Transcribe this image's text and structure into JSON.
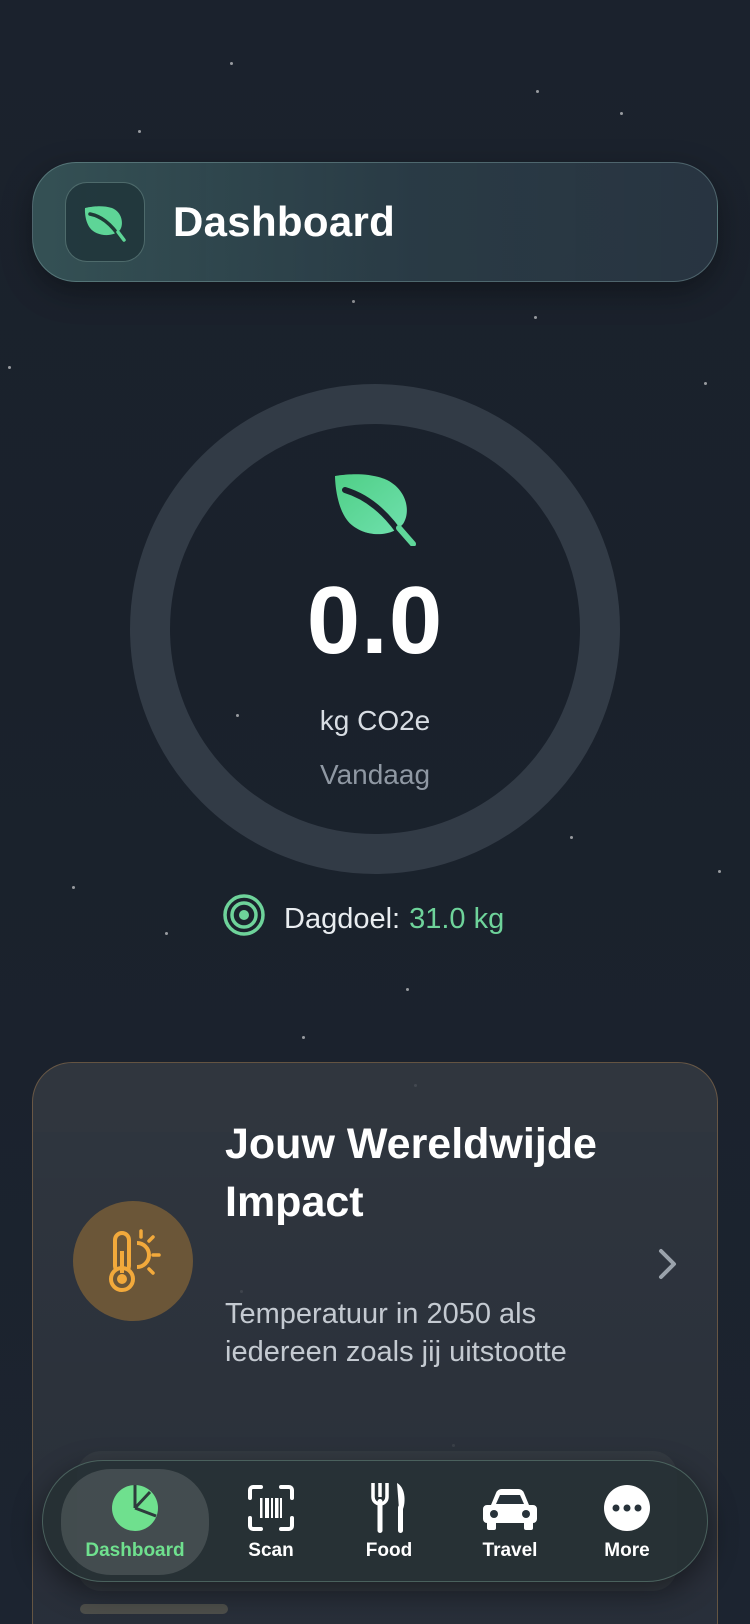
{
  "header": {
    "title": "Dashboard",
    "icon": "leaf-icon"
  },
  "emissions": {
    "value": "0.0",
    "unit": "kg CO2e",
    "period": "Vandaag",
    "progress_fraction": 0.0
  },
  "goal": {
    "label": "Dagdoel:",
    "value": "31.0 kg"
  },
  "impact_card": {
    "title": "Jouw Wereldwijde Impact",
    "description": "Temperatuur in 2050 als iedereen zoals jij uitstootte",
    "icon": "thermometer-sun-icon"
  },
  "tabs": [
    {
      "label": "Dashboard",
      "icon": "pie-chart-icon",
      "active": true
    },
    {
      "label": "Scan",
      "icon": "barcode-scan-icon",
      "active": false
    },
    {
      "label": "Food",
      "icon": "fork-knife-icon",
      "active": false
    },
    {
      "label": "Travel",
      "icon": "car-icon",
      "active": false
    },
    {
      "label": "More",
      "icon": "more-dots-icon",
      "active": false
    }
  ],
  "colors": {
    "accent_green": "#6ed39a",
    "impact_amber": "#f2a93b",
    "background": "#1a212c"
  }
}
